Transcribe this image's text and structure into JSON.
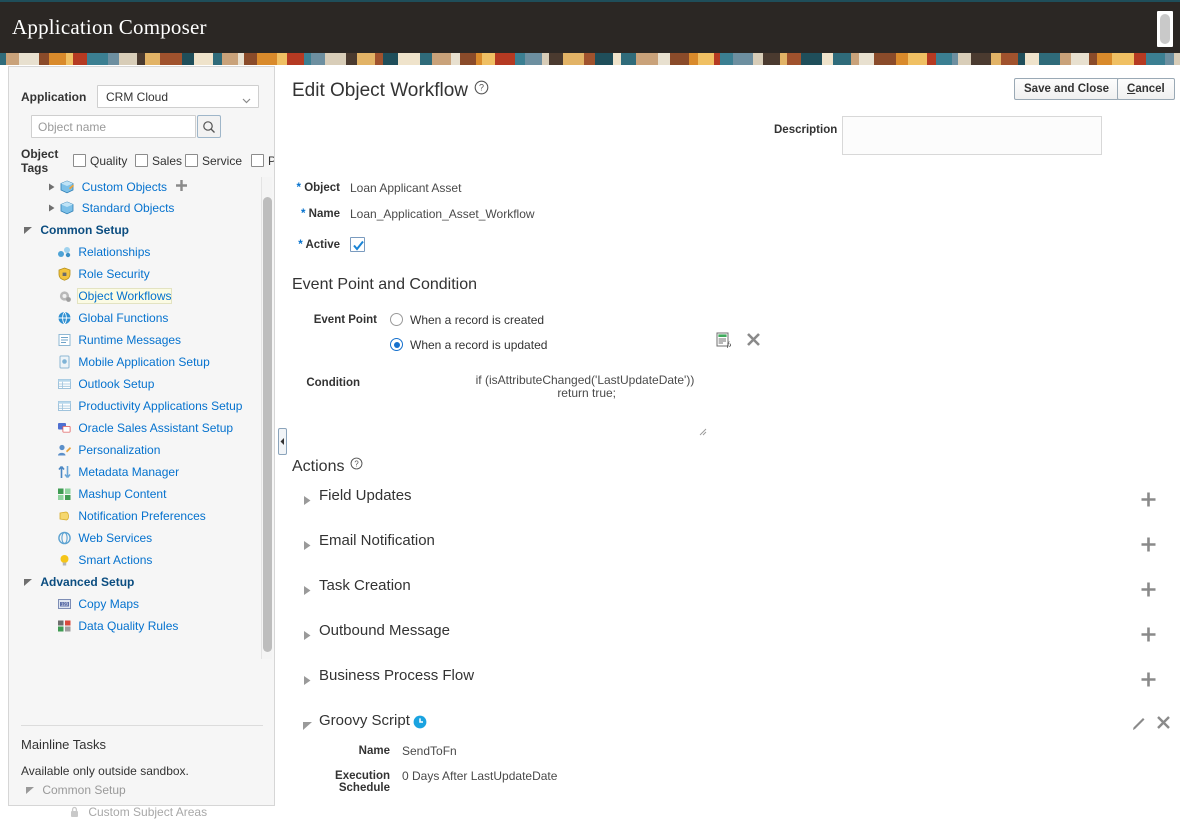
{
  "header": {
    "app_title": "Application Composer",
    "scrollbar_icon": "vertical-scrollbar-thumb"
  },
  "sidebar": {
    "application": {
      "label": "Application",
      "selected": "CRM Cloud",
      "caret_icon": "chevron-down-icon"
    },
    "search": {
      "placeholder": "Object name",
      "value": "",
      "button_icon": "search-icon"
    },
    "object_tags": {
      "label": "Object Tags",
      "tags": [
        {
          "label": "Quality",
          "checked": false
        },
        {
          "label": "Sales",
          "checked": false
        },
        {
          "label": "Service",
          "checked": false
        },
        {
          "label": "PR",
          "checked": false
        }
      ]
    },
    "tree": [
      {
        "label": "Custom Objects",
        "type": "node",
        "icon": "custom-objects-icon",
        "has_add": true,
        "expanded": false
      },
      {
        "label": "Standard Objects",
        "type": "node",
        "icon": "standard-objects-icon",
        "has_add": false,
        "expanded": false
      },
      {
        "label": "Common Setup",
        "type": "group",
        "expanded": true
      },
      {
        "label": "Relationships",
        "type": "link",
        "icon": "relationships-icon"
      },
      {
        "label": "Role Security",
        "type": "link",
        "icon": "shield-icon"
      },
      {
        "label": "Object Workflows",
        "type": "link",
        "icon": "gear-icon",
        "selected": true
      },
      {
        "label": "Global Functions",
        "type": "link",
        "icon": "globe-icon"
      },
      {
        "label": "Runtime Messages",
        "type": "link",
        "icon": "document-lines-icon"
      },
      {
        "label": "Mobile Application Setup",
        "type": "link",
        "icon": "mobile-icon"
      },
      {
        "label": "Outlook Setup",
        "type": "link",
        "icon": "table-icon"
      },
      {
        "label": "Productivity Applications Setup",
        "type": "link",
        "icon": "table-icon"
      },
      {
        "label": "Oracle Sales Assistant Setup",
        "type": "link",
        "icon": "chat-icon"
      },
      {
        "label": "Personalization",
        "type": "link",
        "icon": "personalization-icon"
      },
      {
        "label": "Metadata Manager",
        "type": "link",
        "icon": "arrows-updown-icon"
      },
      {
        "label": "Mashup Content",
        "type": "link",
        "icon": "mashup-icon"
      },
      {
        "label": "Notification Preferences",
        "type": "link",
        "icon": "bell-icon"
      },
      {
        "label": "Web Services",
        "type": "link",
        "icon": "web-services-icon"
      },
      {
        "label": "Smart Actions",
        "type": "link",
        "icon": "lightbulb-icon"
      },
      {
        "label": "Advanced Setup",
        "type": "group",
        "expanded": true
      },
      {
        "label": "Copy Maps",
        "type": "link",
        "icon": "copy-maps-icon"
      },
      {
        "label": "Data Quality Rules",
        "type": "link",
        "icon": "data-quality-icon"
      }
    ],
    "mainline": {
      "title": "Mainline Tasks",
      "note": "Available only outside sandbox.",
      "group": "Common Setup",
      "child": "Custom Subject Areas",
      "child_icon": "lock-icon"
    },
    "collapse_handle_icon": "collapse-left-icon"
  },
  "main": {
    "page_title": "Edit Object Workflow",
    "help_icon": "help-circle-icon",
    "buttons": {
      "save_and_close": "Save and Close",
      "cancel_prefix": "C",
      "cancel_rest": "ancel"
    },
    "fields": {
      "object_label": "Object",
      "object_value": "Loan Applicant Asset",
      "name_label": "Name",
      "name_value": "Loan_Application_Asset_Workflow",
      "active_label": "Active",
      "active_checked": true,
      "active_check_icon": "checkmark-icon",
      "description_label": "Description",
      "description_value": "",
      "required_marker": "*"
    },
    "event_point_section": {
      "title": "Event Point and Condition",
      "event_point_label": "Event Point",
      "options": [
        {
          "label": "When a record is created",
          "selected": false
        },
        {
          "label": "When a record is updated",
          "selected": true
        }
      ],
      "condition_label": "Condition",
      "condition_value": "if (isAttributeChanged('LastUpdateDate'))\n return true;",
      "expression_icon": "expression-editor-icon",
      "clear_icon": "close-x-icon",
      "resize_icon": "resize-grip-icon"
    },
    "actions_section": {
      "title": "Actions",
      "help_icon": "help-circle-icon",
      "rows": [
        {
          "label": "Field Updates",
          "expanded": false,
          "caret_icon": "triangle-right-icon",
          "add_icon": "plus-icon"
        },
        {
          "label": "Email Notification",
          "expanded": false,
          "caret_icon": "triangle-right-icon",
          "add_icon": "plus-icon"
        },
        {
          "label": "Task Creation",
          "expanded": false,
          "caret_icon": "triangle-right-icon",
          "add_icon": "plus-icon"
        },
        {
          "label": "Outbound Message",
          "expanded": false,
          "caret_icon": "triangle-right-icon",
          "add_icon": "plus-icon"
        },
        {
          "label": "Business Process Flow",
          "expanded": false,
          "caret_icon": "triangle-right-icon",
          "add_icon": "plus-icon"
        }
      ],
      "groovy": {
        "label": "Groovy Script",
        "expanded": true,
        "caret_icon": "triangle-down-icon",
        "status_icon": "clock-icon",
        "edit_icon": "pencil-icon",
        "delete_icon": "close-x-icon",
        "name_label": "Name",
        "name_value": "SendToFn",
        "schedule_label": "Execution Schedule",
        "schedule_value": "0 Days After LastUpdateDate"
      }
    }
  },
  "colors": {
    "header_bg": "#2b2724",
    "link_blue": "#0572ce",
    "group_blue": "#0b4d80",
    "accent_blue": "#1570cd",
    "panel_bg": "#f6f6f6"
  }
}
